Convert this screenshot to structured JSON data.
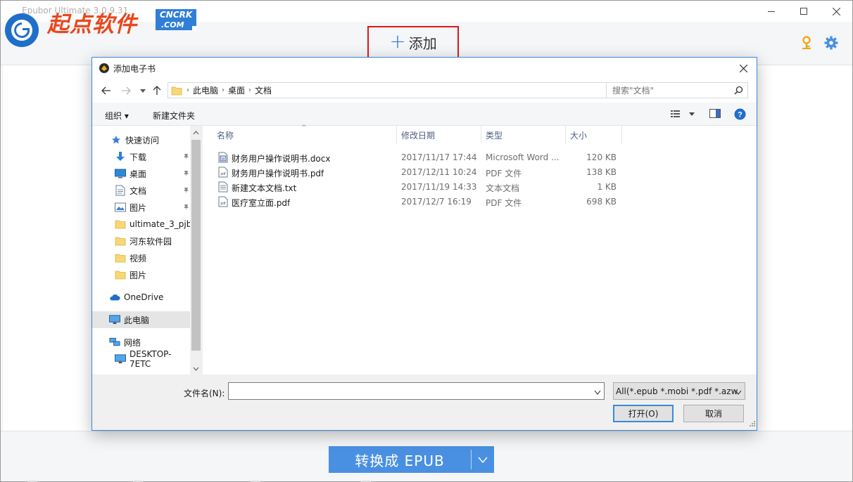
{
  "app": {
    "title": "Epubor Ultimate 3.0.9.31",
    "logo_text": "起点软件",
    "logo_badge_top": "CNCRK",
    "logo_badge_bottom": ".COM",
    "add_button_label": "添加",
    "convert_button_label": "转换成 EPUB",
    "colors": {
      "accent_blue": "#4a90e2",
      "highlight_red": "#e0161a",
      "key_gold": "#f0a818",
      "gear_blue": "#4a90e2"
    }
  },
  "dialog": {
    "title": "添加电子书",
    "breadcrumb": [
      "此电脑",
      "桌面",
      "文档"
    ],
    "search_placeholder": "搜索\"文档\"",
    "toolbar": {
      "organize": "组织 ▾",
      "new_folder": "新建文件夹"
    },
    "nav_items": [
      {
        "label": "快速访问",
        "icon": "star-icon",
        "pinned": false
      },
      {
        "label": "下载",
        "icon": "download-icon",
        "pinned": true
      },
      {
        "label": "桌面",
        "icon": "desktop-icon",
        "pinned": true
      },
      {
        "label": "文档",
        "icon": "document-icon",
        "pinned": true
      },
      {
        "label": "图片",
        "icon": "picture-icon",
        "pinned": true
      },
      {
        "label": "ultimate_3_pjb",
        "icon": "folder-icon",
        "pinned": false
      },
      {
        "label": "河东软件园",
        "icon": "folder-icon",
        "pinned": false
      },
      {
        "label": "视频",
        "icon": "folder-icon",
        "pinned": false
      },
      {
        "label": "图片",
        "icon": "folder-icon",
        "pinned": false
      },
      {
        "label": "OneDrive",
        "icon": "cloud-icon",
        "pinned": false
      },
      {
        "label": "此电脑",
        "icon": "computer-icon",
        "pinned": false,
        "selected": true
      },
      {
        "label": "网络",
        "icon": "network-icon",
        "pinned": false
      },
      {
        "label": "DESKTOP-7ETC",
        "icon": "computer-icon",
        "pinned": false
      }
    ],
    "columns": {
      "name": "名称",
      "modified": "修改日期",
      "type": "类型",
      "size": "大小"
    },
    "files": [
      {
        "name": "财务用户操作说明书.docx",
        "modified": "2017/11/17 17:44",
        "type": "Microsoft Word ...",
        "size": "120 KB",
        "icon": "word-doc-icon"
      },
      {
        "name": "财务用户操作说明书.pdf",
        "modified": "2017/12/11 10:24",
        "type": "PDF 文件",
        "size": "138 KB",
        "icon": "pdf-file-icon"
      },
      {
        "name": "新建文本文档.txt",
        "modified": "2017/11/19 14:33",
        "type": "文本文档",
        "size": "1 KB",
        "icon": "text-file-icon"
      },
      {
        "name": "医疗室立面.pdf",
        "modified": "2017/12/7 16:19",
        "type": "PDF 文件",
        "size": "698 KB",
        "icon": "pdf-file-icon"
      }
    ],
    "filename_label": "文件名(N):",
    "filename_value": "",
    "filetype_value": "All(*.epub *.mobi *.pdf *.azw",
    "open_button": "打开(O)",
    "cancel_button": "取消"
  }
}
